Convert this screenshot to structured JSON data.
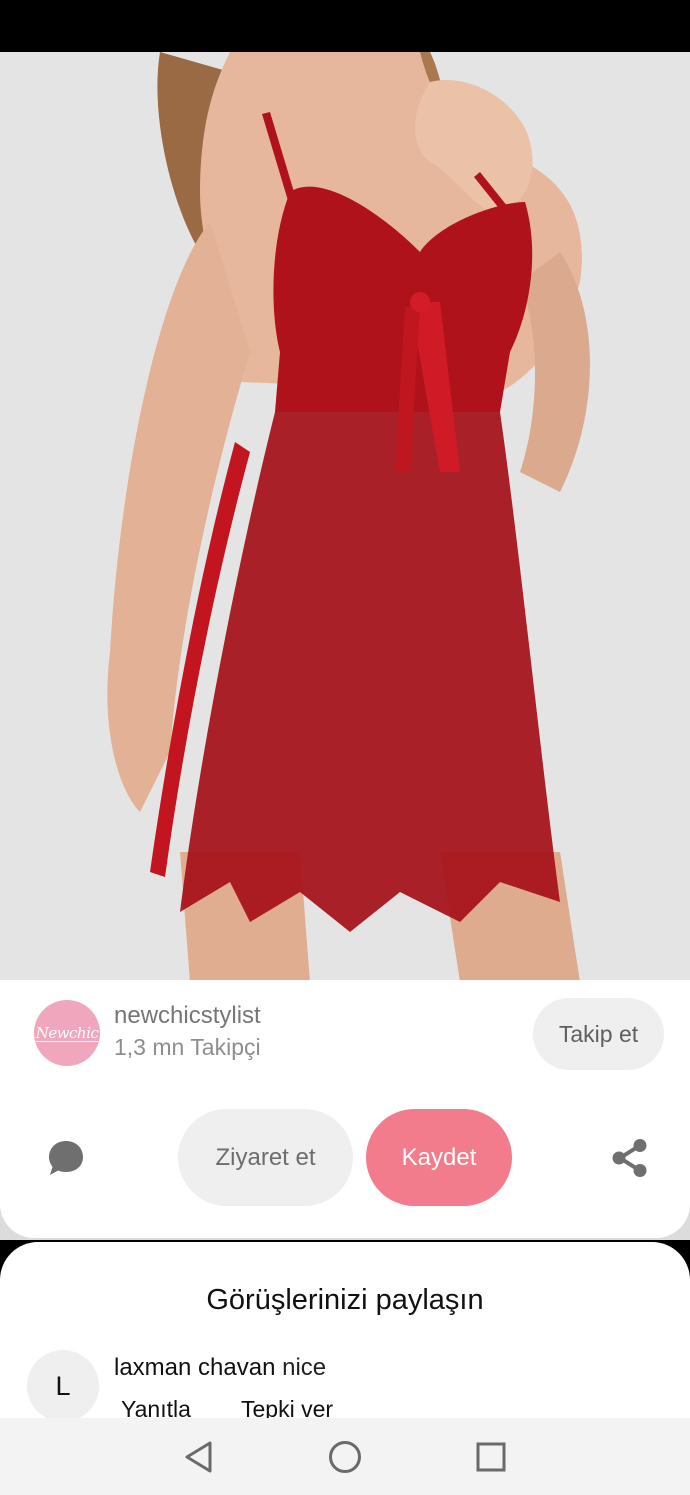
{
  "creator": {
    "avatar_text": "Newchic",
    "name": "newchicstylist",
    "followers": "1,3 mn Takipçi",
    "follow_label": "Takip et"
  },
  "actions": {
    "visit_label": "Ziyaret et",
    "save_label": "Kaydet",
    "comment_icon": "comment-bubble-icon",
    "share_icon": "share-icon"
  },
  "comments": {
    "title": "Görüşlerinizi paylaşın",
    "items": [
      {
        "avatar_letter": "L",
        "author": "laxman chavan",
        "text": " nice",
        "reply_label": "Yanıtla",
        "react_label": "Tepki ver"
      }
    ]
  },
  "nav": {
    "back_icon": "back-triangle-icon",
    "home_icon": "home-circle-icon",
    "recents_icon": "recents-square-icon"
  },
  "colors": {
    "save_button": "#f27b8c",
    "avatar_brand": "#f0a7bd",
    "garment": "#b0121c"
  }
}
